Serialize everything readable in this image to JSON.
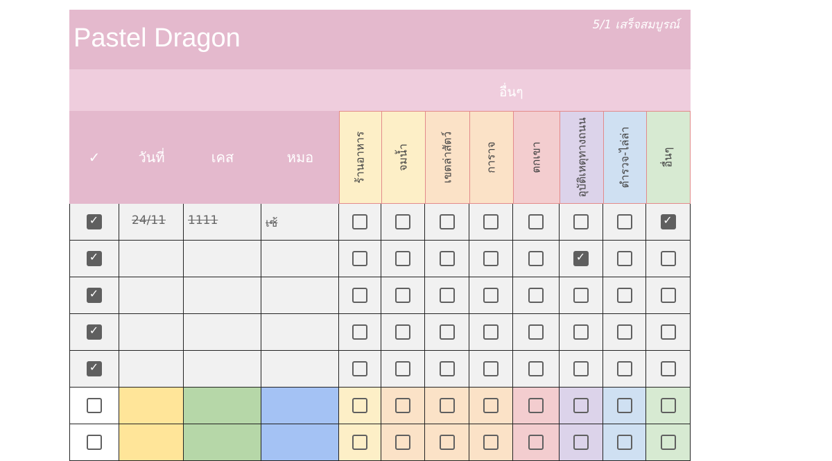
{
  "sheet": {
    "title": "Pastel Dragon",
    "status": "5/1 เสร็จสมบูรณ์",
    "group_label": "อื่นๆ",
    "headers": {
      "check": "✓",
      "date": "วันที่",
      "case": "เคส",
      "doctor": "หมอ"
    },
    "categories": [
      {
        "label": "ร้านอาหาร",
        "header_color": "#fdefc7",
        "row_color": "#fdefc7"
      },
      {
        "label": "จมน้ำ",
        "header_color": "#fdefc7",
        "row_color": "#fbe2c7"
      },
      {
        "label": "เขตล่าสัตว์",
        "header_color": "#fbe2c7",
        "row_color": "#fbe2c7"
      },
      {
        "label": "การาจ",
        "header_color": "#fbe2c7",
        "row_color": "#fbe2c7"
      },
      {
        "label": "ตกเขา",
        "header_color": "#f3cdcf",
        "row_color": "#f3cdcf"
      },
      {
        "label": "อุบัติเหตุทางถนน",
        "header_color": "#dcd3ea",
        "row_color": "#dcd3ea"
      },
      {
        "label": "ตำรวจ-ไล่ล่า",
        "header_color": "#cfe0f2",
        "row_color": "#cfe0f2"
      },
      {
        "label": "อื่นๆ",
        "header_color": "#d7ead2",
        "row_color": "#d7ead2"
      }
    ],
    "rows": [
      {
        "done": true,
        "date": "24/11",
        "case": "1111",
        "doctor": "เซ้",
        "flags": [
          false,
          false,
          false,
          false,
          false,
          false,
          false,
          true
        ]
      },
      {
        "done": true,
        "date": "",
        "case": "",
        "doctor": "",
        "flags": [
          false,
          false,
          false,
          false,
          false,
          true,
          false,
          false
        ]
      },
      {
        "done": true,
        "date": "",
        "case": "",
        "doctor": "",
        "flags": [
          false,
          false,
          false,
          false,
          false,
          false,
          false,
          false
        ]
      },
      {
        "done": true,
        "date": "",
        "case": "",
        "doctor": "",
        "flags": [
          false,
          false,
          false,
          false,
          false,
          false,
          false,
          false
        ]
      },
      {
        "done": true,
        "date": "",
        "case": "",
        "doctor": "",
        "flags": [
          false,
          false,
          false,
          false,
          false,
          false,
          false,
          false
        ]
      },
      {
        "done": false,
        "date": "",
        "case": "",
        "doctor": "",
        "flags": [
          false,
          false,
          false,
          false,
          false,
          false,
          false,
          false
        ],
        "pastel": true
      },
      {
        "done": false,
        "date": "",
        "case": "",
        "doctor": "",
        "flags": [
          false,
          false,
          false,
          false,
          false,
          false,
          false,
          false
        ],
        "pastel": true
      }
    ],
    "colors": {
      "title_band": "#e4b9cd",
      "group_band": "#efcddd",
      "grey_cell": "#f1f1f1",
      "date_cell": "#ffe599",
      "case_cell": "#b6d7a8",
      "doctor_cell": "#a4c2f4",
      "check_dark": "#5f5f5f"
    }
  }
}
